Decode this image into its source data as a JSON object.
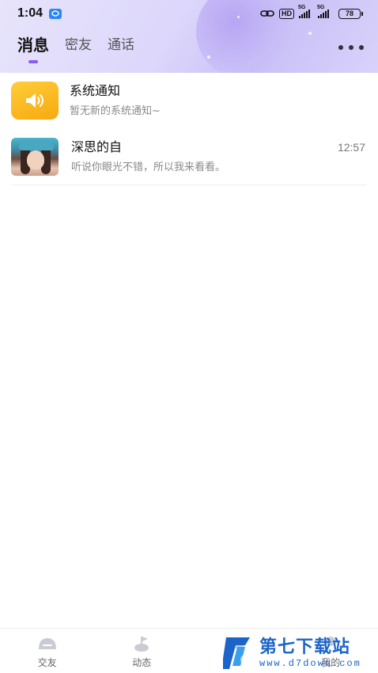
{
  "status_bar": {
    "time": "1:04",
    "hd_label": "HD",
    "network_1": "5G",
    "network_2": "5G",
    "battery": "78"
  },
  "header": {
    "tabs": [
      {
        "label": "消息",
        "active": true
      },
      {
        "label": "密友",
        "active": false
      },
      {
        "label": "通话",
        "active": false
      }
    ],
    "more_icon": "more-dots-icon"
  },
  "conversations": [
    {
      "title": "系统通知",
      "preview": "暂无新的系统通知~",
      "time": "",
      "icon": "speaker-icon"
    },
    {
      "title": "深思的自",
      "preview": "听说你眼光不错，所以我来看看。",
      "time": "12:57",
      "icon": "avatar"
    }
  ],
  "bottom_nav": [
    {
      "label": "交友",
      "icon": "friends-icon"
    },
    {
      "label": "动态",
      "icon": "moments-icon"
    },
    {
      "label": "",
      "icon": "message-icon"
    },
    {
      "label": "我的",
      "icon": "profile-icon"
    }
  ],
  "watermark": {
    "cn": "第七下载站",
    "url": "www.d7down.com"
  },
  "colors": {
    "accent": "#8a5cf0",
    "notify": "#f7a90f",
    "watermark": "#1d64c8"
  }
}
